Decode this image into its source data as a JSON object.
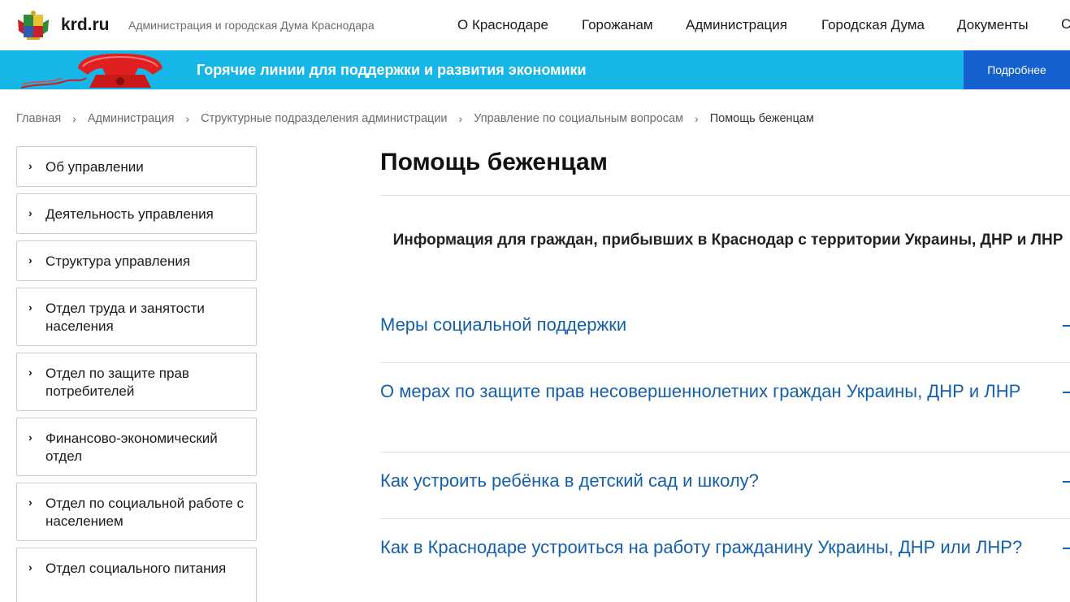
{
  "header": {
    "site_name": "krd.ru",
    "subtitle": "Администрация и городская Дума Краснодара",
    "nav": [
      {
        "label": "О Краснодаре"
      },
      {
        "label": "Горожанам"
      },
      {
        "label": "Администрация"
      },
      {
        "label": "Городская Дума"
      },
      {
        "label": "Документы"
      }
    ],
    "nav_cut_glyph": "С"
  },
  "banner": {
    "text": "Горячие линии для поддержки и развития экономики",
    "button_label": "Подробнее",
    "background": "#17b6e8",
    "button_color": "#1460cc",
    "icon": "red-telephone-icon"
  },
  "breadcrumb": {
    "items": [
      {
        "label": "Главная"
      },
      {
        "label": "Администрация"
      },
      {
        "label": "Структурные подразделения администрации"
      },
      {
        "label": "Управление по социальным вопросам"
      }
    ],
    "current": "Помощь беженцам",
    "separator": "›"
  },
  "sidebar": {
    "items": [
      {
        "label": "Об управлении"
      },
      {
        "label": "Деятельность управления"
      },
      {
        "label": "Структура управления"
      },
      {
        "label": "Отдел труда и занятости населения"
      },
      {
        "label": "Отдел по защите прав потребителей"
      },
      {
        "label": "Финансово-экономический отдел"
      },
      {
        "label": "Отдел по социальной работе с населением"
      },
      {
        "label": "Отдел социального питания"
      }
    ]
  },
  "main": {
    "title": "Помощь беженцам",
    "subtitle": "Информация для граждан, прибывших в Краснодар с территории Украины, ДНР и ЛНР",
    "accordion": [
      {
        "title": "Меры социальной поддержки"
      },
      {
        "title": "О мерах по защите прав несовершеннолетних граждан Украины, ДНР и ЛНР"
      },
      {
        "title": "Как устроить ребёнка в детский сад и школу?"
      },
      {
        "title": "Как в Краснодаре устроиться на работу гражданину Украины, ДНР или ЛНР?"
      }
    ],
    "link_color": "#1460aa"
  }
}
